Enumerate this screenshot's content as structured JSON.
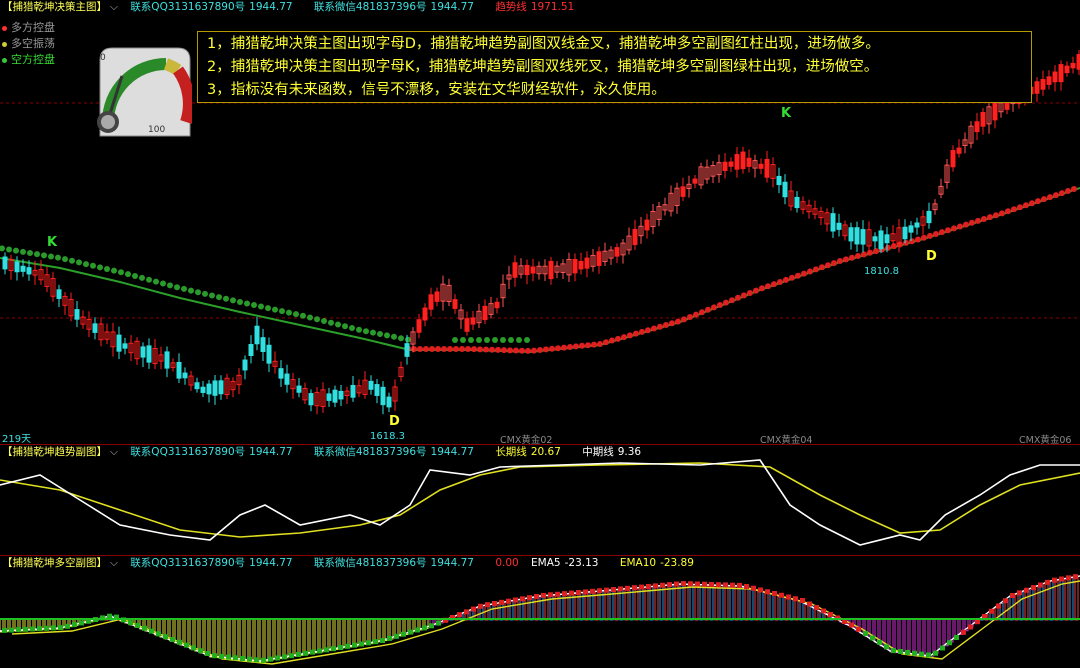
{
  "panel1": {
    "title": "【捕猎乾坤决策主图】",
    "qq": "联系QQ3131637890号",
    "qq_value": "1944.77",
    "wechat": "联系微信481837396号",
    "wechat_value": "1944.77",
    "trend_label": "趋势线",
    "trend_value": "1971.51",
    "legend": [
      {
        "label": "多方控盘",
        "color": "#ff3333"
      },
      {
        "label": "多空振荡",
        "color": "#cccc33"
      },
      {
        "label": "空方控盘",
        "color": "#33cc33"
      }
    ],
    "gauge": {
      "min_label": "0",
      "max_label": "100",
      "needle_value": 12
    },
    "notice_lines": [
      "1，捕猎乾坤决策主图出现字母D，捕猎乾坤趋势副图双线金叉，捕猎乾坤多空副图红柱出现，进场做多。",
      "2，捕猎乾坤决策主图出现字母K，捕猎乾坤趋势副图双线死叉，捕猎乾坤多空副图绿柱出现，进场做空。",
      "3，指标没有未来函数，信号不漂移，安装在文华财经软件，永久使用。"
    ],
    "signals": {
      "k1": "K",
      "k2": "K",
      "d1": "D",
      "d2": "D"
    },
    "low1": "1618.3",
    "low2": "1810.8",
    "days": "219天",
    "contracts": [
      "CMX黄金02",
      "CMX黄金04",
      "CMX黄金06"
    ]
  },
  "panel2": {
    "title": "【捕猎乾坤趋势副图】",
    "qq": "联系QQ3131637890号",
    "qq_value": "1944.77",
    "wechat": "联系微信481837396号",
    "wechat_value": "1944.77",
    "long_label": "长期线",
    "long_value": "20.67",
    "mid_label": "中期线",
    "mid_value": "9.36"
  },
  "panel3": {
    "title": "【捕猎乾坤多空副图】",
    "qq": "联系QQ3131637890号",
    "qq_value": "1944.77",
    "wechat": "联系微信481837396号",
    "wechat_value": "1944.77",
    "zero_value": "0.00",
    "ema5_label": "EMA5",
    "ema5_value": "-23.13",
    "ema10_label": "EMA10",
    "ema10_value": "-23.89"
  },
  "colors": {
    "up": "#ff2020",
    "down": "#30e0e0",
    "green": "#2a9a2a",
    "yellow": "#e0e020",
    "white": "#ffffff",
    "magenta": "#d030d0"
  }
}
